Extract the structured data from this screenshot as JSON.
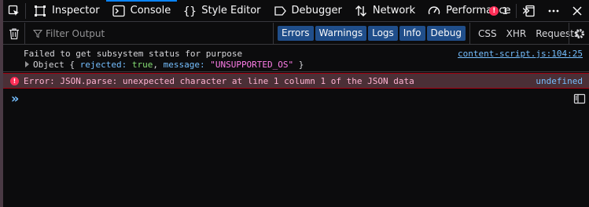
{
  "toolbar": {
    "tabs": [
      {
        "label": "Inspector"
      },
      {
        "label": "Console"
      },
      {
        "label": "Style Editor"
      },
      {
        "label": "Debugger"
      },
      {
        "label": "Network"
      },
      {
        "label": "Performance"
      }
    ],
    "error_count": "1"
  },
  "filterbar": {
    "placeholder": "Filter Output",
    "levels": [
      "Errors",
      "Warnings",
      "Logs",
      "Info",
      "Debug"
    ],
    "types": [
      "CSS",
      "XHR",
      "Requests"
    ]
  },
  "messages": {
    "log": {
      "text": "Failed to get subsystem status for purpose",
      "obj_prefix": "Object { ",
      "key1": "rejected: ",
      "val1": "true",
      "sep": ", ",
      "key2": "message: ",
      "val2": "\"UNSUPPORTED_OS\"",
      "obj_suffix": " }",
      "location": "content-script.js:104:25"
    },
    "error": {
      "text": "Error: JSON.parse: unexpected character at line 1 column 1 of the JSON data",
      "location": "undefined"
    }
  },
  "colors": {
    "accent": "#0a84ff",
    "error_bg": "#4b2f36",
    "error_badge": "#ff2e57"
  }
}
